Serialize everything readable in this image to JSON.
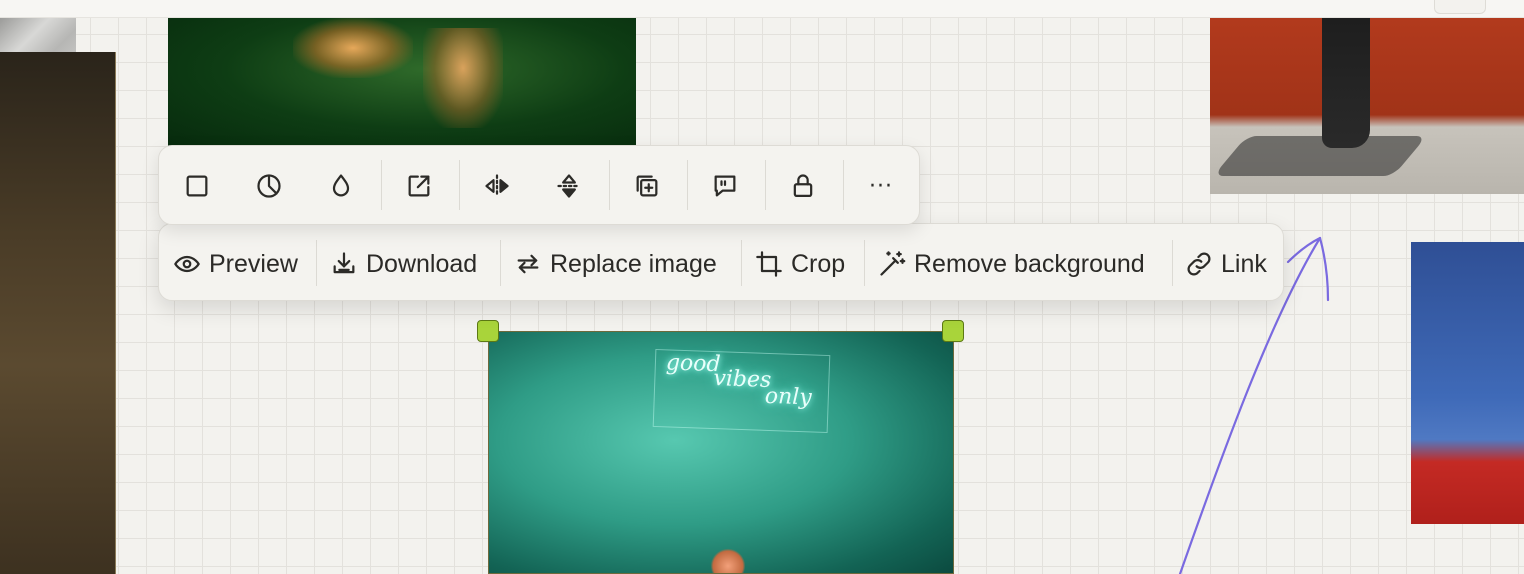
{
  "canvas": {
    "grid_color": "#e3e1dc",
    "background": "#f3f2ee",
    "selection_handle_color": "#a9d43a",
    "arrow_color": "#7a6ae0"
  },
  "image_toolbar": {
    "icon_buttons": [
      {
        "name": "shape-icon"
      },
      {
        "name": "corner-radius-icon"
      },
      {
        "name": "opacity-drop-icon"
      },
      {
        "name": "open-external-icon"
      },
      {
        "name": "flip-horizontal-icon"
      },
      {
        "name": "flip-vertical-icon"
      },
      {
        "name": "duplicate-icon"
      },
      {
        "name": "comment-icon"
      },
      {
        "name": "lock-icon"
      },
      {
        "name": "more-icon",
        "label": "···"
      }
    ],
    "actions": [
      {
        "id": "preview",
        "label": "Preview",
        "icon": "eye-icon"
      },
      {
        "id": "download",
        "label": "Download",
        "icon": "download-icon"
      },
      {
        "id": "replace",
        "label": "Replace image",
        "icon": "replace-icon"
      },
      {
        "id": "crop",
        "label": "Crop",
        "icon": "crop-icon"
      },
      {
        "id": "remove_bg",
        "label": "Remove background",
        "icon": "magic-wand-icon"
      },
      {
        "id": "link",
        "label": "Link",
        "icon": "link-icon"
      }
    ]
  }
}
